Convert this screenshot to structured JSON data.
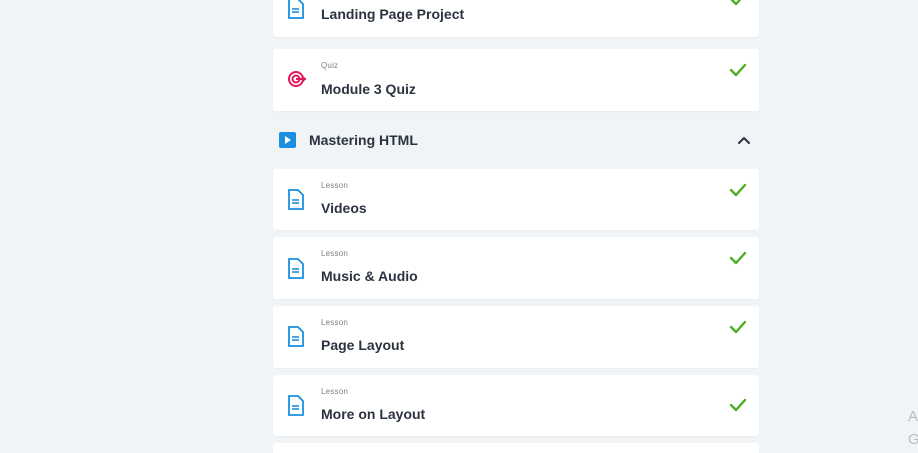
{
  "colors": {
    "background": "#f1f4f7",
    "card": "#ffffff",
    "text": "#2b3340",
    "muted": "#7a7f87",
    "lesson_icon": "#1a8fe0",
    "quiz_icon": "#e0195e",
    "check": "#4caf23"
  },
  "items_top": [
    {
      "type": "",
      "title": "Landing Page Project",
      "icon": "lesson-document-icon",
      "completed": true
    },
    {
      "type": "Quiz",
      "title": "Module 3 Quiz",
      "icon": "quiz-target-icon",
      "completed": true
    }
  ],
  "section": {
    "title": "Mastering HTML",
    "icon": "play-icon",
    "expanded": true,
    "toggle_icon": "chevron-up-icon"
  },
  "items": [
    {
      "type": "Lesson",
      "title": "Videos",
      "icon": "lesson-document-icon",
      "completed": true
    },
    {
      "type": "Lesson",
      "title": "Music & Audio",
      "icon": "lesson-document-icon",
      "completed": true
    },
    {
      "type": "Lesson",
      "title": "Page Layout",
      "icon": "lesson-document-icon",
      "completed": true
    },
    {
      "type": "Lesson",
      "title": "More on Layout",
      "icon": "lesson-document-icon",
      "completed": true
    }
  ],
  "side_fragment": {
    "line1": "A",
    "line2": "G"
  }
}
